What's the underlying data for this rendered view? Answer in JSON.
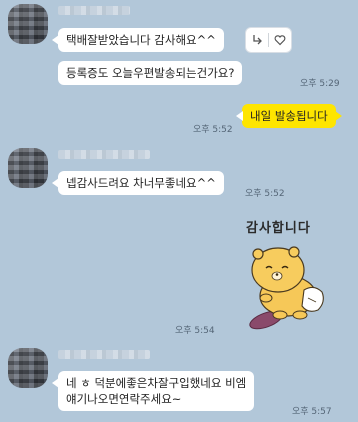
{
  "messages": {
    "m1": {
      "text": "택배잘받았습니다 감사해요^^"
    },
    "m2": {
      "text": "등록증도 오늘우편발송되는건가요?",
      "time": "오후 5:29"
    },
    "m3": {
      "text": "내일 발송됩니다",
      "time": "오후 5:52"
    },
    "m4": {
      "text": "넵감사드려요 차너무좋네요^^",
      "time": "오후 5:52"
    },
    "sticker": {
      "caption": "감사합니다",
      "time": "오후 5:54"
    },
    "m5": {
      "line1": "네 ㅎ 덕분에좋은차잘구입했네요 비엠",
      "line2": "얘기나오면연락주세요~",
      "time": "오후 5:57"
    }
  },
  "icons": {
    "reply": "reply-arrow-icon",
    "like": "heart-icon"
  },
  "colors": {
    "background": "#b2c7d9",
    "my_bubble": "#fee500",
    "other_bubble": "#ffffff"
  }
}
